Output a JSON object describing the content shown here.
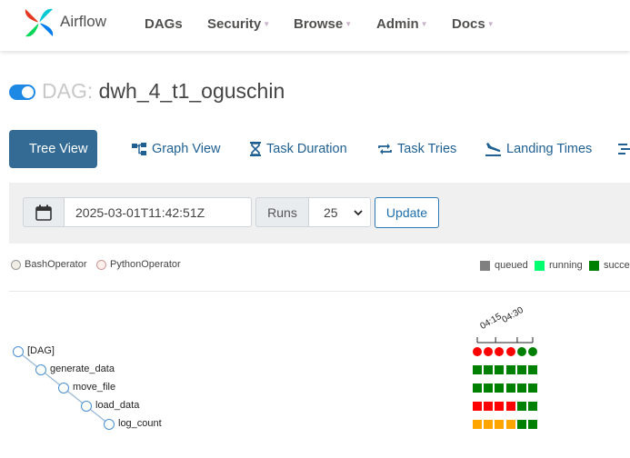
{
  "navbar": {
    "brand": "Airflow",
    "items": [
      {
        "label": "DAGs",
        "has_caret": false
      },
      {
        "label": "Security",
        "has_caret": true
      },
      {
        "label": "Browse",
        "has_caret": true
      },
      {
        "label": "Admin",
        "has_caret": true
      },
      {
        "label": "Docs",
        "has_caret": true
      }
    ]
  },
  "dag": {
    "prefix": "DAG:",
    "dag_id": "dwh_4_t1_oguschin",
    "paused": false
  },
  "tabs": [
    {
      "label": "Tree View",
      "icon": "tree-icon",
      "active": true
    },
    {
      "label": "Graph View",
      "icon": "graph-icon",
      "active": false
    },
    {
      "label": "Task Duration",
      "icon": "hourglass-icon",
      "active": false
    },
    {
      "label": "Task Tries",
      "icon": "repeat-icon",
      "active": false
    },
    {
      "label": "Landing Times",
      "icon": "plane-landing-icon",
      "active": false
    }
  ],
  "form": {
    "base_date": "2025-03-01T11:42:51Z",
    "runs_label": "Runs",
    "runs_value": "25",
    "update_label": "Update"
  },
  "operator_legend": [
    {
      "label": "BashOperator",
      "color": "#f0ede4"
    },
    {
      "label": "PythonOperator",
      "color": "#ffefeb"
    }
  ],
  "state_legend": [
    {
      "label": "queued",
      "color": "#808080"
    },
    {
      "label": "running",
      "color": "#01ff70"
    },
    {
      "label": "succes",
      "color": "#008000"
    }
  ],
  "tree": {
    "nodes": [
      "[DAG]",
      "generate_data",
      "move_file",
      "load_data",
      "log_count"
    ],
    "time_labels": [
      "04:15",
      "04:30"
    ],
    "dag_runs": [
      "#ff0000",
      "#ff0000",
      "#ff0000",
      "#ff0000",
      "#008000",
      "#008000"
    ],
    "task_instances": [
      [
        "#008000",
        "#008000",
        "#008000",
        "#008000",
        "#008000",
        "#008000"
      ],
      [
        "#008000",
        "#008000",
        "#008000",
        "#008000",
        "#008000",
        "#008000"
      ],
      [
        "#ff0000",
        "#ff0000",
        "#ff0000",
        "#ff0000",
        "#008000",
        "#008000"
      ],
      [
        "#ffa500",
        "#ffa500",
        "#ffa500",
        "#ffa500",
        "#008000",
        "#008000"
      ]
    ]
  }
}
